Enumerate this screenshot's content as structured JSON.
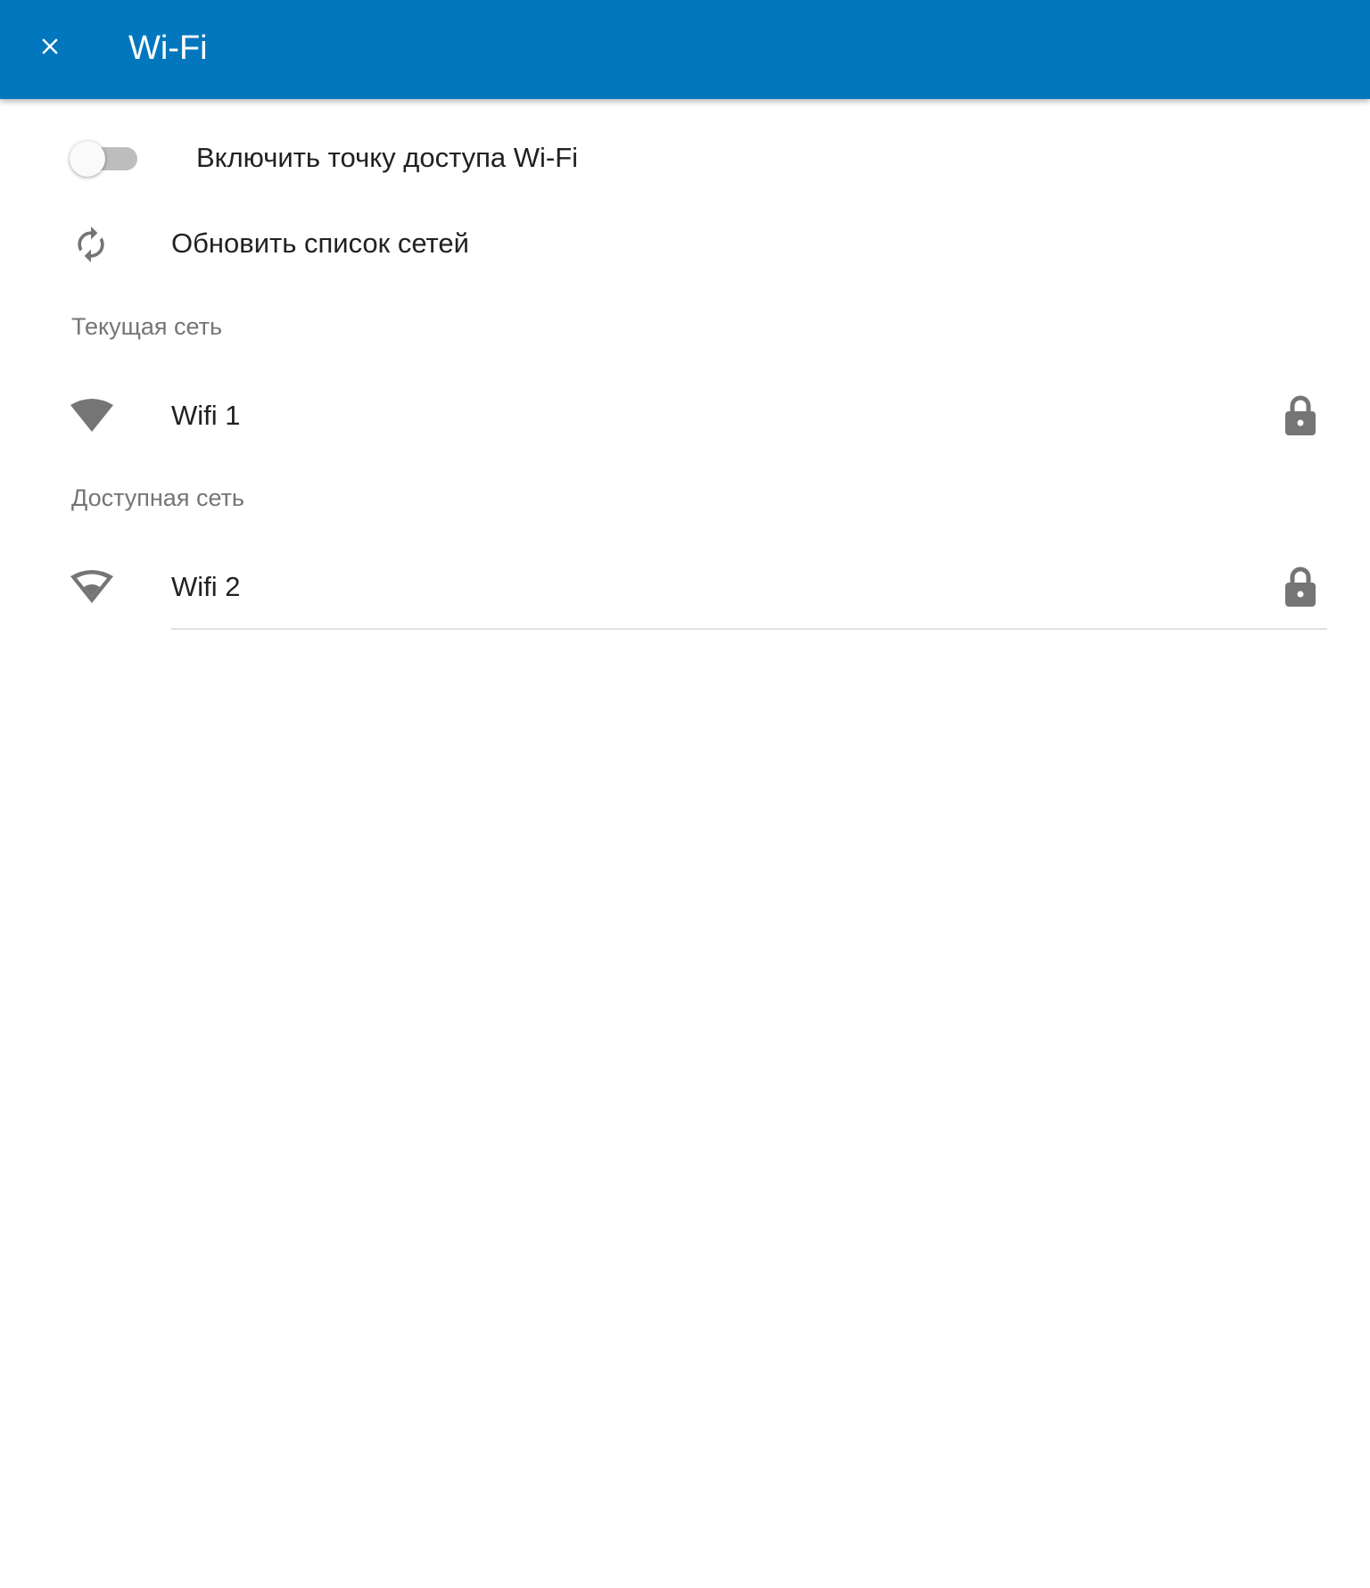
{
  "appbar": {
    "title": "Wi-Fi",
    "close_icon": "close-icon",
    "background_color": "#0277bd"
  },
  "hotspot": {
    "label": "Включить точку доступа Wi-Fi",
    "enabled": false
  },
  "refresh": {
    "label": "Обновить список сетей",
    "icon": "refresh-icon"
  },
  "current_network": {
    "header": "Текущая сеть",
    "items": [
      {
        "name": "Wifi 1",
        "signal_icon": "wifi-signal-full-icon",
        "secured": true,
        "lock_icon": "lock-icon"
      }
    ]
  },
  "available_networks": {
    "header": "Доступная сеть",
    "items": [
      {
        "name": "Wifi 2",
        "signal_icon": "wifi-signal-medium-icon",
        "secured": true,
        "lock_icon": "lock-icon"
      }
    ]
  },
  "colors": {
    "icon_gray": "#757575",
    "text_primary": "#212121",
    "text_secondary": "#757575"
  }
}
